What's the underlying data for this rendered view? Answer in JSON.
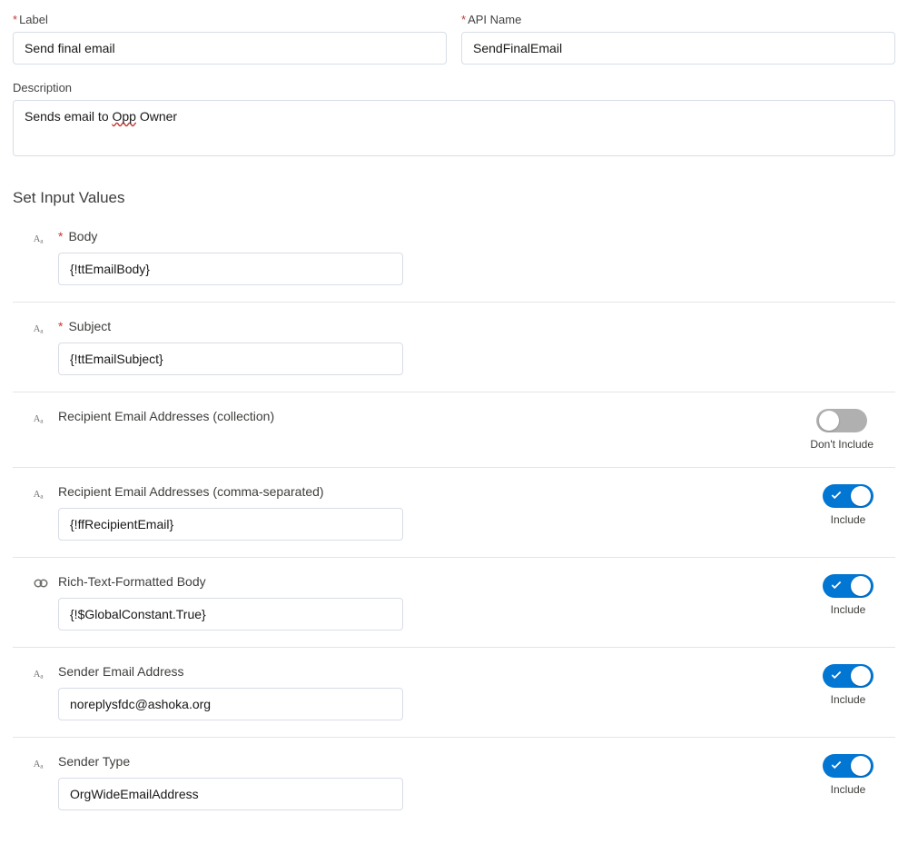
{
  "header": {
    "label_field": {
      "label": "Label",
      "value": "Send final email"
    },
    "apiname_field": {
      "label": "API Name",
      "value": "SendFinalEmail"
    },
    "description_field": {
      "label": "Description",
      "value_pre": "Sends email to ",
      "value_spell": "Opp",
      "value_post": " Owner"
    }
  },
  "section_title": "Set Input Values",
  "toggle_captions": {
    "on": "Include",
    "off": "Don't Include"
  },
  "inputs": {
    "body": {
      "icon": "text",
      "label": "Body",
      "required": true,
      "value": "{!ttEmailBody}",
      "has_value_input": true,
      "has_toggle": false
    },
    "subject": {
      "icon": "text",
      "label": "Subject",
      "required": true,
      "value": "{!ttEmailSubject}",
      "has_value_input": true,
      "has_toggle": false
    },
    "recipients_collection": {
      "icon": "text",
      "label": "Recipient Email Addresses (collection)",
      "required": false,
      "has_value_input": false,
      "has_toggle": true,
      "toggle_on": false
    },
    "recipients_csv": {
      "icon": "text",
      "label": "Recipient Email Addresses (comma-separated)",
      "required": false,
      "value": "{!ffRecipientEmail}",
      "has_value_input": true,
      "has_toggle": true,
      "toggle_on": true
    },
    "richtext": {
      "icon": "link",
      "label": "Rich-Text-Formatted Body",
      "required": false,
      "value": "{!$GlobalConstant.True}",
      "has_value_input": true,
      "has_toggle": true,
      "toggle_on": true
    },
    "sender_email": {
      "icon": "text",
      "label": "Sender Email Address",
      "required": false,
      "value": "noreplysfdc@ashoka.org",
      "has_value_input": true,
      "has_toggle": true,
      "toggle_on": true
    },
    "sender_type": {
      "icon": "text",
      "label": "Sender Type",
      "required": false,
      "value": "OrgWideEmailAddress",
      "has_value_input": true,
      "has_toggle": true,
      "toggle_on": true
    }
  }
}
